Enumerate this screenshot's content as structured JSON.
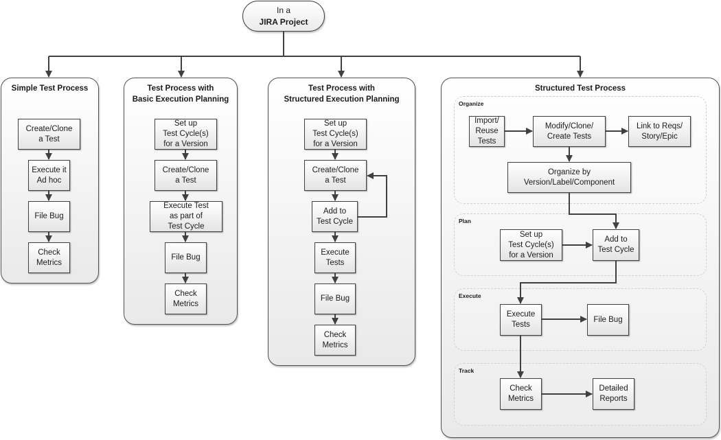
{
  "root": {
    "line1": "In a",
    "line2": "JIRA Project"
  },
  "groups": {
    "simple": {
      "title": "Simple Test Process",
      "steps": [
        "Create/Clone\na Test",
        "Execute it\nAd hoc",
        "File Bug",
        "Check\nMetrics"
      ]
    },
    "basic": {
      "title": "Test Process with\nBasic Execution Planning",
      "steps": [
        "Set up\nTest Cycle(s)\nfor a Version",
        "Create/Clone\na Test",
        "Execute Test\nas part of\nTest Cycle",
        "File Bug",
        "Check\nMetrics"
      ]
    },
    "structured_exec": {
      "title": "Test Process with\nStructured Execution Planning",
      "steps": [
        "Set up\nTest Cycle(s)\nfor a Version",
        "Create/Clone\na Test",
        "Add to\nTest Cycle",
        "Execute\nTests",
        "File Bug",
        "Check\nMetrics"
      ]
    },
    "structured": {
      "title": "Structured Test Process",
      "lanes": {
        "organize": {
          "title": "Organize",
          "steps": [
            "Import/\nReuse\nTests",
            "Modify/Clone/\nCreate Tests",
            "Link to Reqs/\nStory/Epic",
            "Organize by\nVersion/Label/Component"
          ]
        },
        "plan": {
          "title": "Plan",
          "steps": [
            "Set up\nTest Cycle(s)\nfor a Version",
            "Add to\nTest Cycle"
          ]
        },
        "execute": {
          "title": "Execute",
          "steps": [
            "Execute\nTests",
            "File Bug"
          ]
        },
        "track": {
          "title": "Track",
          "steps": [
            "Check\nMetrics",
            "Detailed\nReports"
          ]
        }
      }
    }
  }
}
